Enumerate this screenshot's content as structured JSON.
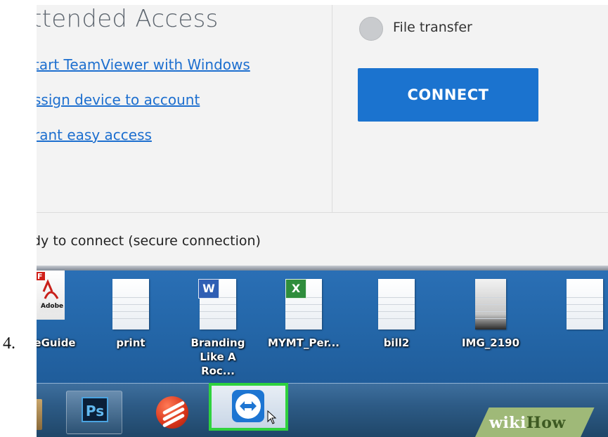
{
  "step_number": "4.",
  "teamviewer": {
    "section_title": "ttended Access",
    "links": [
      "tart TeamViewer with Windows",
      "ssign device to account",
      "rant easy access"
    ],
    "file_transfer_label": "File transfer",
    "connect_label": "CONNECT",
    "status": "dy to connect (secure connection)"
  },
  "desktop": {
    "icons": [
      {
        "label": "eGuide",
        "icon": "pdf-file-icon",
        "badge": "Adobe"
      },
      {
        "label": "print",
        "icon": "text-file-icon"
      },
      {
        "label": "Branding\nLike A Roc...",
        "icon": "word-document-icon",
        "badge": "W"
      },
      {
        "label": "MYMT_Per...",
        "icon": "excel-spreadsheet-icon",
        "badge": "X"
      },
      {
        "label": "bill2",
        "icon": "text-file-icon"
      },
      {
        "label": "IMG_2190",
        "icon": "image-file-icon"
      }
    ]
  },
  "taskbar": {
    "items": [
      {
        "name": "photoshop",
        "icon": "photoshop-icon",
        "text": "Ps"
      },
      {
        "name": "app-ball",
        "icon": "red-ball-app-icon"
      },
      {
        "name": "teamviewer",
        "icon": "teamviewer-icon",
        "highlighted": true
      }
    ]
  },
  "watermark": {
    "part1": "wiki",
    "part2": "How"
  },
  "colors": {
    "connect_button": "#1b73cf",
    "link": "#1d6fcf",
    "highlight": "#2fd23e",
    "desktop": "#2467a9"
  }
}
